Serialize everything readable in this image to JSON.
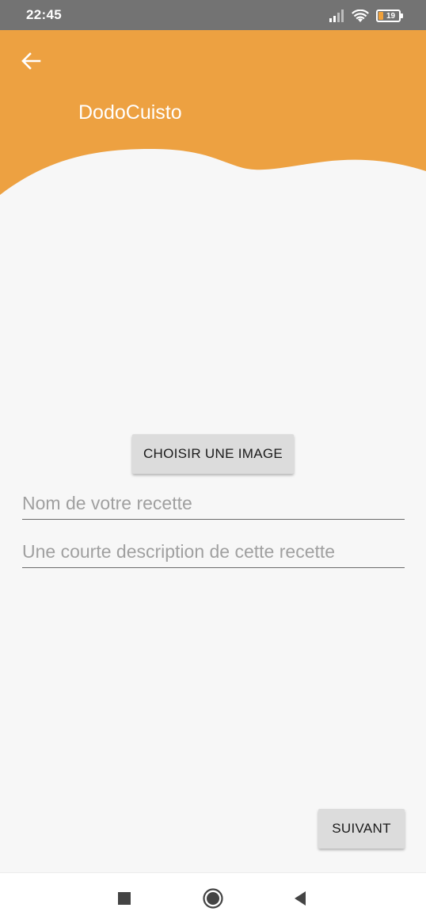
{
  "status_bar": {
    "time": "22:45",
    "battery_level": "19",
    "icons": [
      "signal-icon",
      "wifi-icon",
      "battery-icon"
    ]
  },
  "header": {
    "title": "DodoCuisto",
    "back_icon": "arrow-left-icon",
    "color": "#eda141"
  },
  "form": {
    "choose_image_label": "CHOISIR UNE IMAGE",
    "recipe_name_placeholder": "Nom de votre recette",
    "recipe_name_value": "",
    "recipe_description_placeholder": "Une courte description de cette recette",
    "recipe_description_value": "",
    "next_label": "SUIVANT"
  },
  "nav_bar": {
    "icons": [
      "recent-apps-icon",
      "home-icon",
      "back-icon"
    ]
  }
}
